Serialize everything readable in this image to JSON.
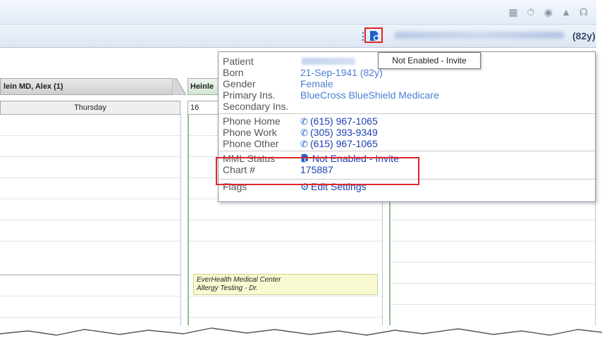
{
  "toolbar_icons": [
    "map-icon",
    "stopwatch-icon",
    "binoculars-icon",
    "graduation-cap-icon",
    "headset-icon"
  ],
  "header": {
    "age": "(82y)"
  },
  "tooltip": {
    "text": "Not Enabled - Invite"
  },
  "schedule": {
    "col1_header": "lein MD, Alex (1)",
    "col1_day": "Thursday",
    "col2_header": "Heinle",
    "col2_day": "16",
    "appointment_line1": "EverHealth Medical Center",
    "appointment_line2": "Allergy Testing - Dr."
  },
  "popup": {
    "rows": [
      {
        "label": "Patient",
        "value": ""
      },
      {
        "label": "Born",
        "value": "21-Sep-1941 (82y)"
      },
      {
        "label": "Gender",
        "value": "Female"
      },
      {
        "label": "Primary Ins.",
        "value": "BlueCross BlueShield Medicare"
      },
      {
        "label": "Secondary Ins.",
        "value": ""
      },
      {
        "label": "Phone Home",
        "value": "(615) 967-1065"
      },
      {
        "label": "Phone Work",
        "value": "(305) 393-9349"
      },
      {
        "label": "Phone Other",
        "value": "(615) 967-1065"
      },
      {
        "label": "MML Status",
        "value": "Not Enabled - Invite"
      },
      {
        "label": "Chart #",
        "value": "175887"
      },
      {
        "label": "Flags",
        "value": "Edit Settings"
      }
    ]
  },
  "colors": {
    "highlight": "#e0262b",
    "link": "#1e3fb0",
    "accent": "#4a7fd3"
  }
}
